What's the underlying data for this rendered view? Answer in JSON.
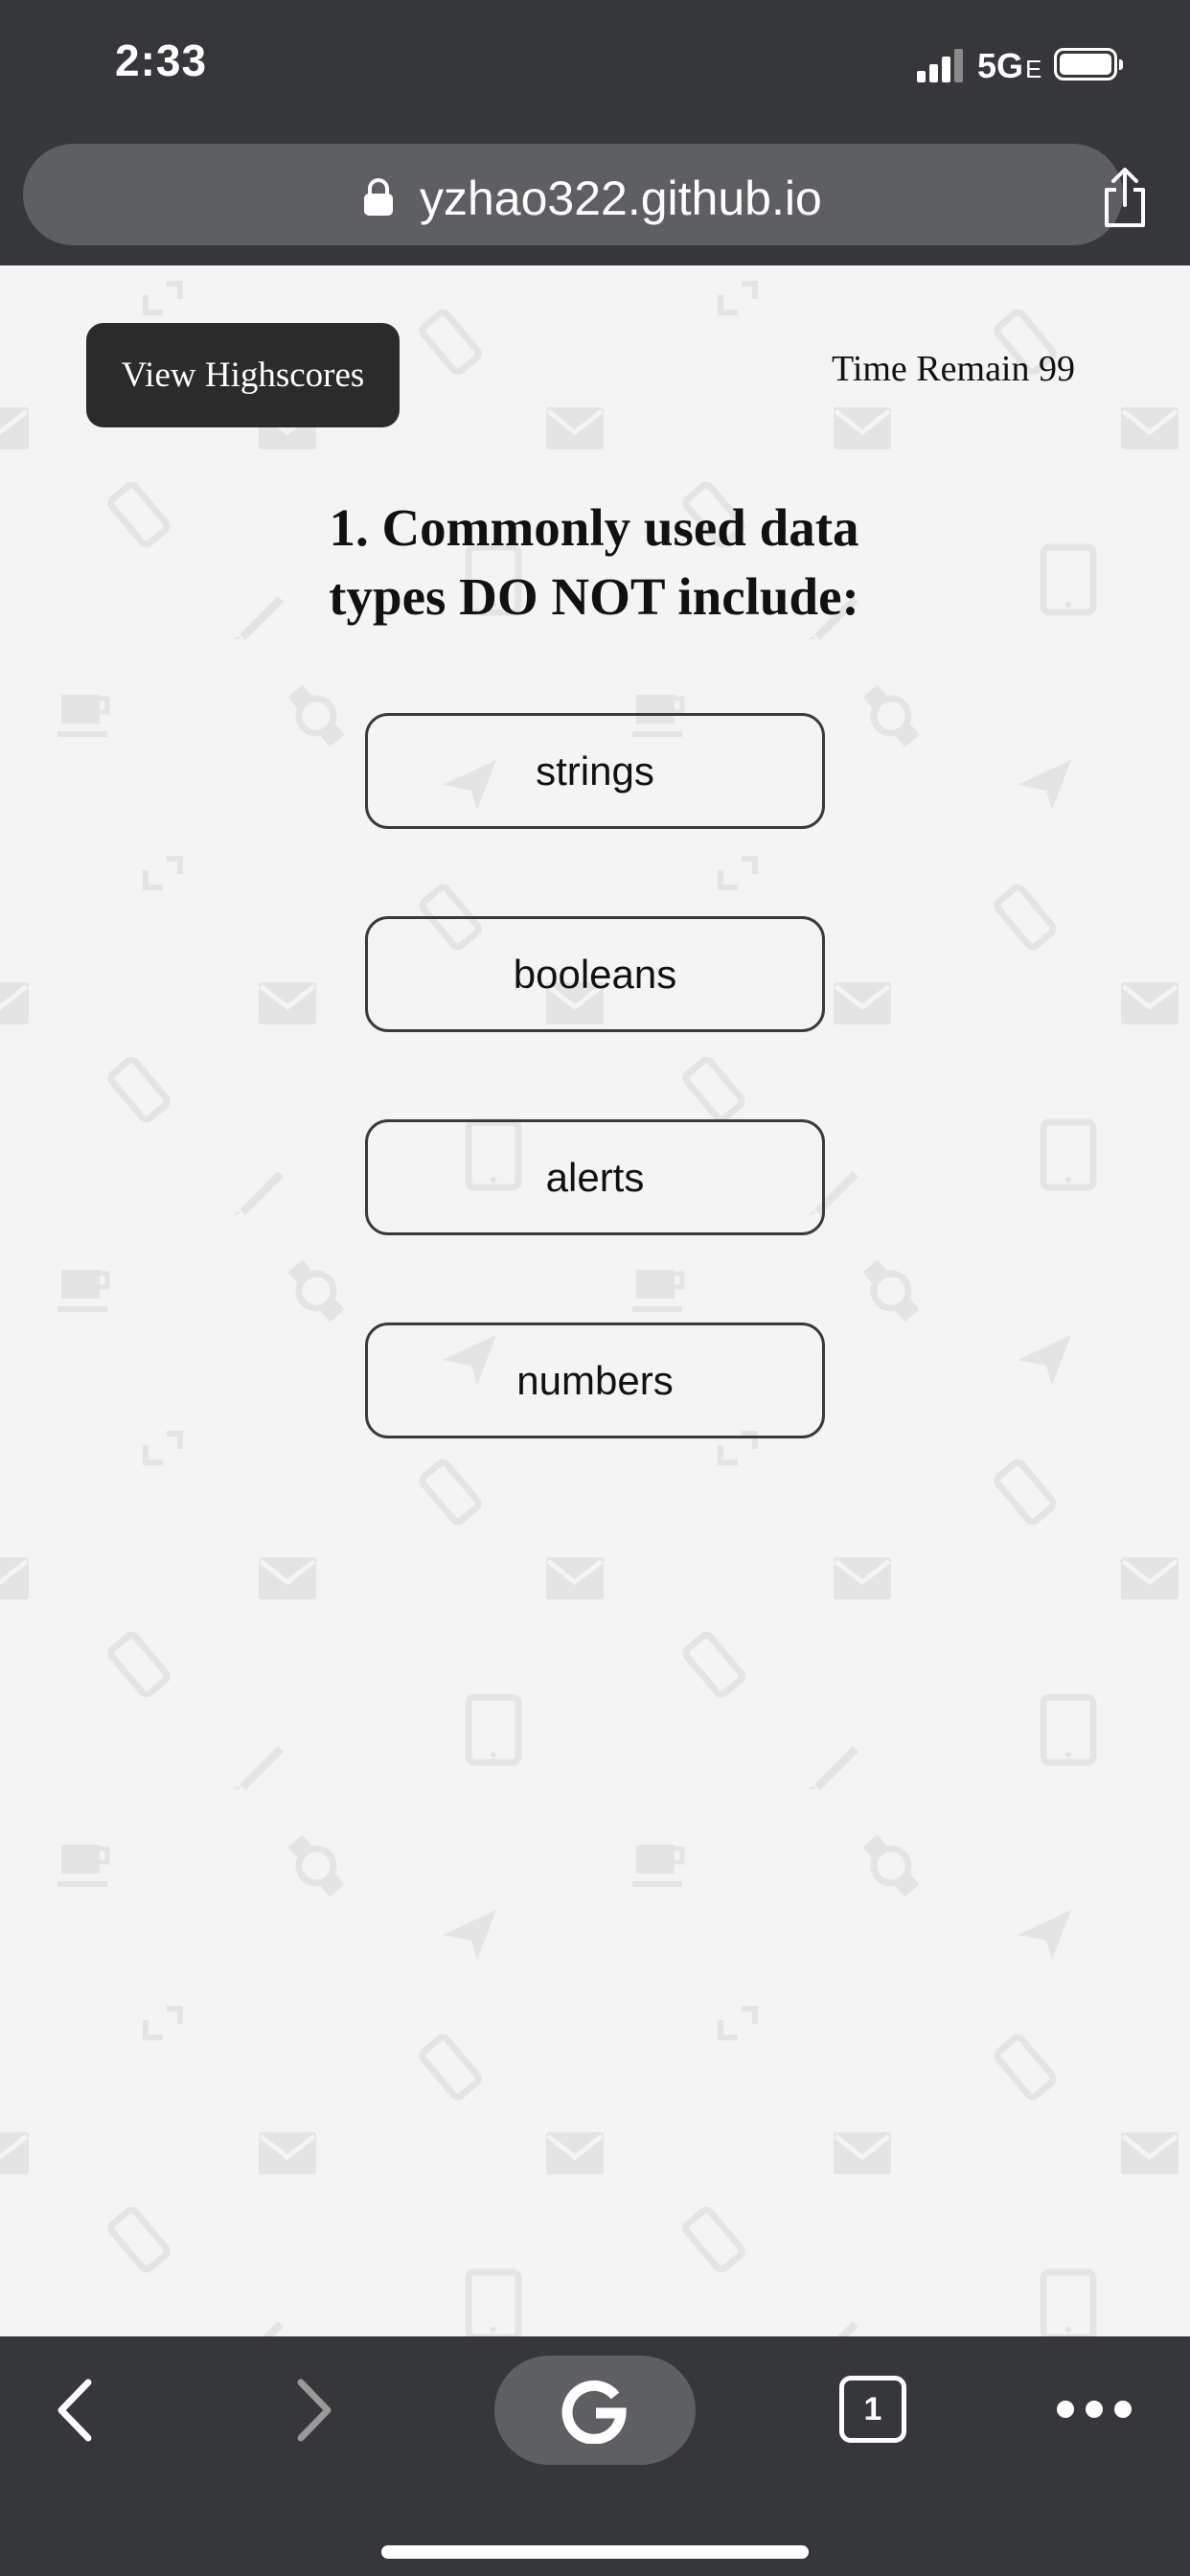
{
  "status_bar": {
    "time": "2:33",
    "network": "5G",
    "network_suffix": "E",
    "icons": [
      "signal-icon",
      "battery-icon"
    ]
  },
  "browser": {
    "url": "yzhao322.github.io",
    "icons": [
      "lock-icon",
      "share-icon"
    ]
  },
  "quiz": {
    "highscores_label": "View Highscores",
    "timer_text": "Time Remain 99",
    "question": "1. Commonly used data types DO NOT include:",
    "answers": [
      "strings",
      "booleans",
      "alerts",
      "numbers"
    ]
  },
  "toolbar": {
    "tab_count": "1",
    "icons": [
      "back-icon",
      "forward-icon",
      "google-icon",
      "tabs-icon",
      "more-icon"
    ]
  },
  "colors": {
    "chrome_bg": "#36373a",
    "pill_bg": "#5d5f62",
    "page_bg": "#f4f4f4",
    "button_dark": "#2b2b2b"
  }
}
